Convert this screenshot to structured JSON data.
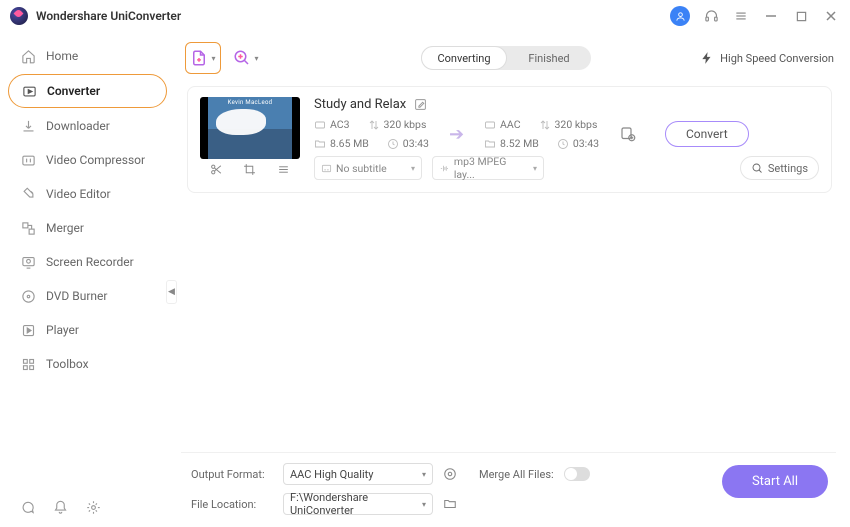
{
  "app": {
    "name": "Wondershare UniConverter"
  },
  "sidebar": {
    "items": [
      {
        "label": "Home",
        "icon": "home-icon"
      },
      {
        "label": "Converter",
        "icon": "converter-icon",
        "active": true
      },
      {
        "label": "Downloader",
        "icon": "downloader-icon"
      },
      {
        "label": "Video Compressor",
        "icon": "compressor-icon"
      },
      {
        "label": "Video Editor",
        "icon": "editor-icon"
      },
      {
        "label": "Merger",
        "icon": "merger-icon"
      },
      {
        "label": "Screen Recorder",
        "icon": "screen-recorder-icon"
      },
      {
        "label": "DVD Burner",
        "icon": "dvd-burner-icon"
      },
      {
        "label": "Player",
        "icon": "player-icon"
      },
      {
        "label": "Toolbox",
        "icon": "toolbox-icon"
      }
    ]
  },
  "tabs": {
    "converting": "Converting",
    "finished": "Finished",
    "active": "converting"
  },
  "high_speed_label": "High Speed Conversion",
  "file": {
    "name": "Study and Relax",
    "thumb_artist": "Kevin MacLeod",
    "source": {
      "format": "AC3",
      "bitrate": "320 kbps",
      "size": "8.65 MB",
      "duration": "03:43"
    },
    "target": {
      "format": "AAC",
      "bitrate": "320 kbps",
      "size": "8.52 MB",
      "duration": "03:43"
    },
    "subtitle_dropdown": "No subtitle",
    "audio_dropdown": "mp3 MPEG lay...",
    "settings_label": "Settings",
    "convert_label": "Convert"
  },
  "bottom": {
    "output_format_label": "Output Format:",
    "output_format_value": "AAC High Quality",
    "file_location_label": "File Location:",
    "file_location_value": "F:\\Wondershare UniConverter",
    "merge_label": "Merge All Files:",
    "start_all_label": "Start All"
  }
}
